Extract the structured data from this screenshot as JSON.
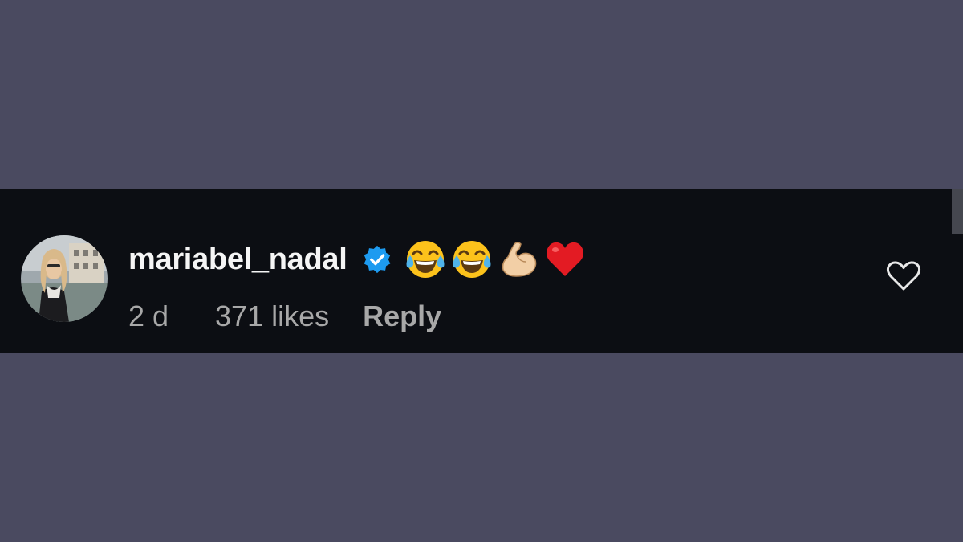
{
  "comment": {
    "username": "mariabel_nadal",
    "verified": true,
    "emojis": [
      "face-with-tears-of-joy",
      "face-with-tears-of-joy",
      "flexed-biceps-light-skin",
      "red-heart"
    ],
    "time": "2 d",
    "likes": "371 likes",
    "reply": "Reply"
  },
  "colors": {
    "page_background": "#4a4a60",
    "bar_background": "#0c0e13",
    "verified_badge": "#1d9bf0",
    "heart": "#e0245e"
  }
}
